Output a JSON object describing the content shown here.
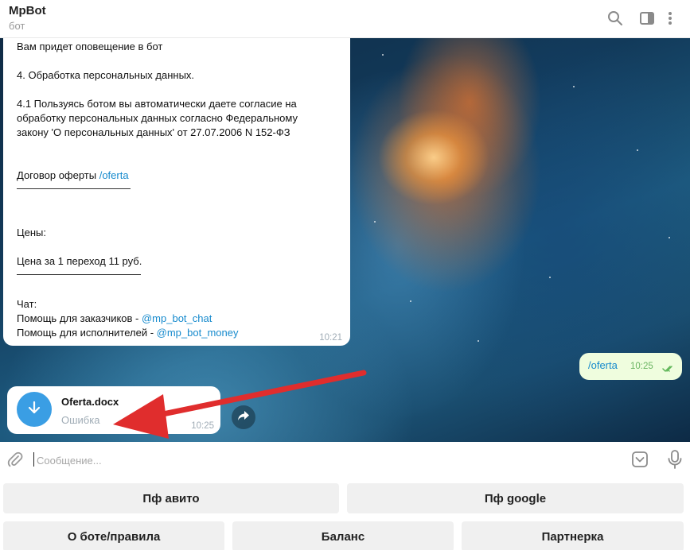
{
  "header": {
    "title": "MpBot",
    "subtitle": "бот",
    "icons": [
      "search-icon",
      "sidebar-toggle-icon",
      "more-vertical-icon"
    ]
  },
  "messages": {
    "bot_text": {
      "lines": {
        "l1": "Вам придет оповещение в бот",
        "l2": "4. Обработка персональных данных.",
        "l3": "4.1 Пользуясь ботом вы автоматически даете согласие на",
        "l4": "обработку персональных данных согласно Федеральному",
        "l5": "закону 'О персональных данных' от 27.07.2006 N 152-ФЗ",
        "l6_prefix": "Договор оферты ",
        "l6_link": "/oferta",
        "l7": "———————————",
        "l8": "Цены:",
        "l9": "Цена за 1 переход 11 руб.",
        "l10": "————————————",
        "l11": "Чат:",
        "l12_prefix": "Помощь для заказчиков - ",
        "l12_link": "@mp_bot_chat",
        "l13_prefix": "Помощь для исполнителей - ",
        "l13_link": "@mp_bot_money"
      },
      "time": "10:21"
    },
    "user_command": {
      "text": "/oferta",
      "time": "10:25",
      "status_icon": "double-check-icon"
    },
    "file": {
      "name": "Oferta.docx",
      "status": "Ошибка",
      "time": "10:25",
      "icon": "download-icon"
    }
  },
  "annotation": {
    "color": "#e02d2d",
    "icon": "red-arrow-annotation"
  },
  "input": {
    "placeholder": "Сообщение..."
  },
  "keyboard": {
    "row1": [
      "Пф авито",
      "Пф google"
    ],
    "row2": [
      "О боте/правила",
      "Баланс",
      "Партнерка"
    ]
  },
  "colors": {
    "accent": "#168acd",
    "download_button": "#3a9ee4",
    "outgoing_bubble": "#effdde",
    "read_check": "#5fb658"
  }
}
